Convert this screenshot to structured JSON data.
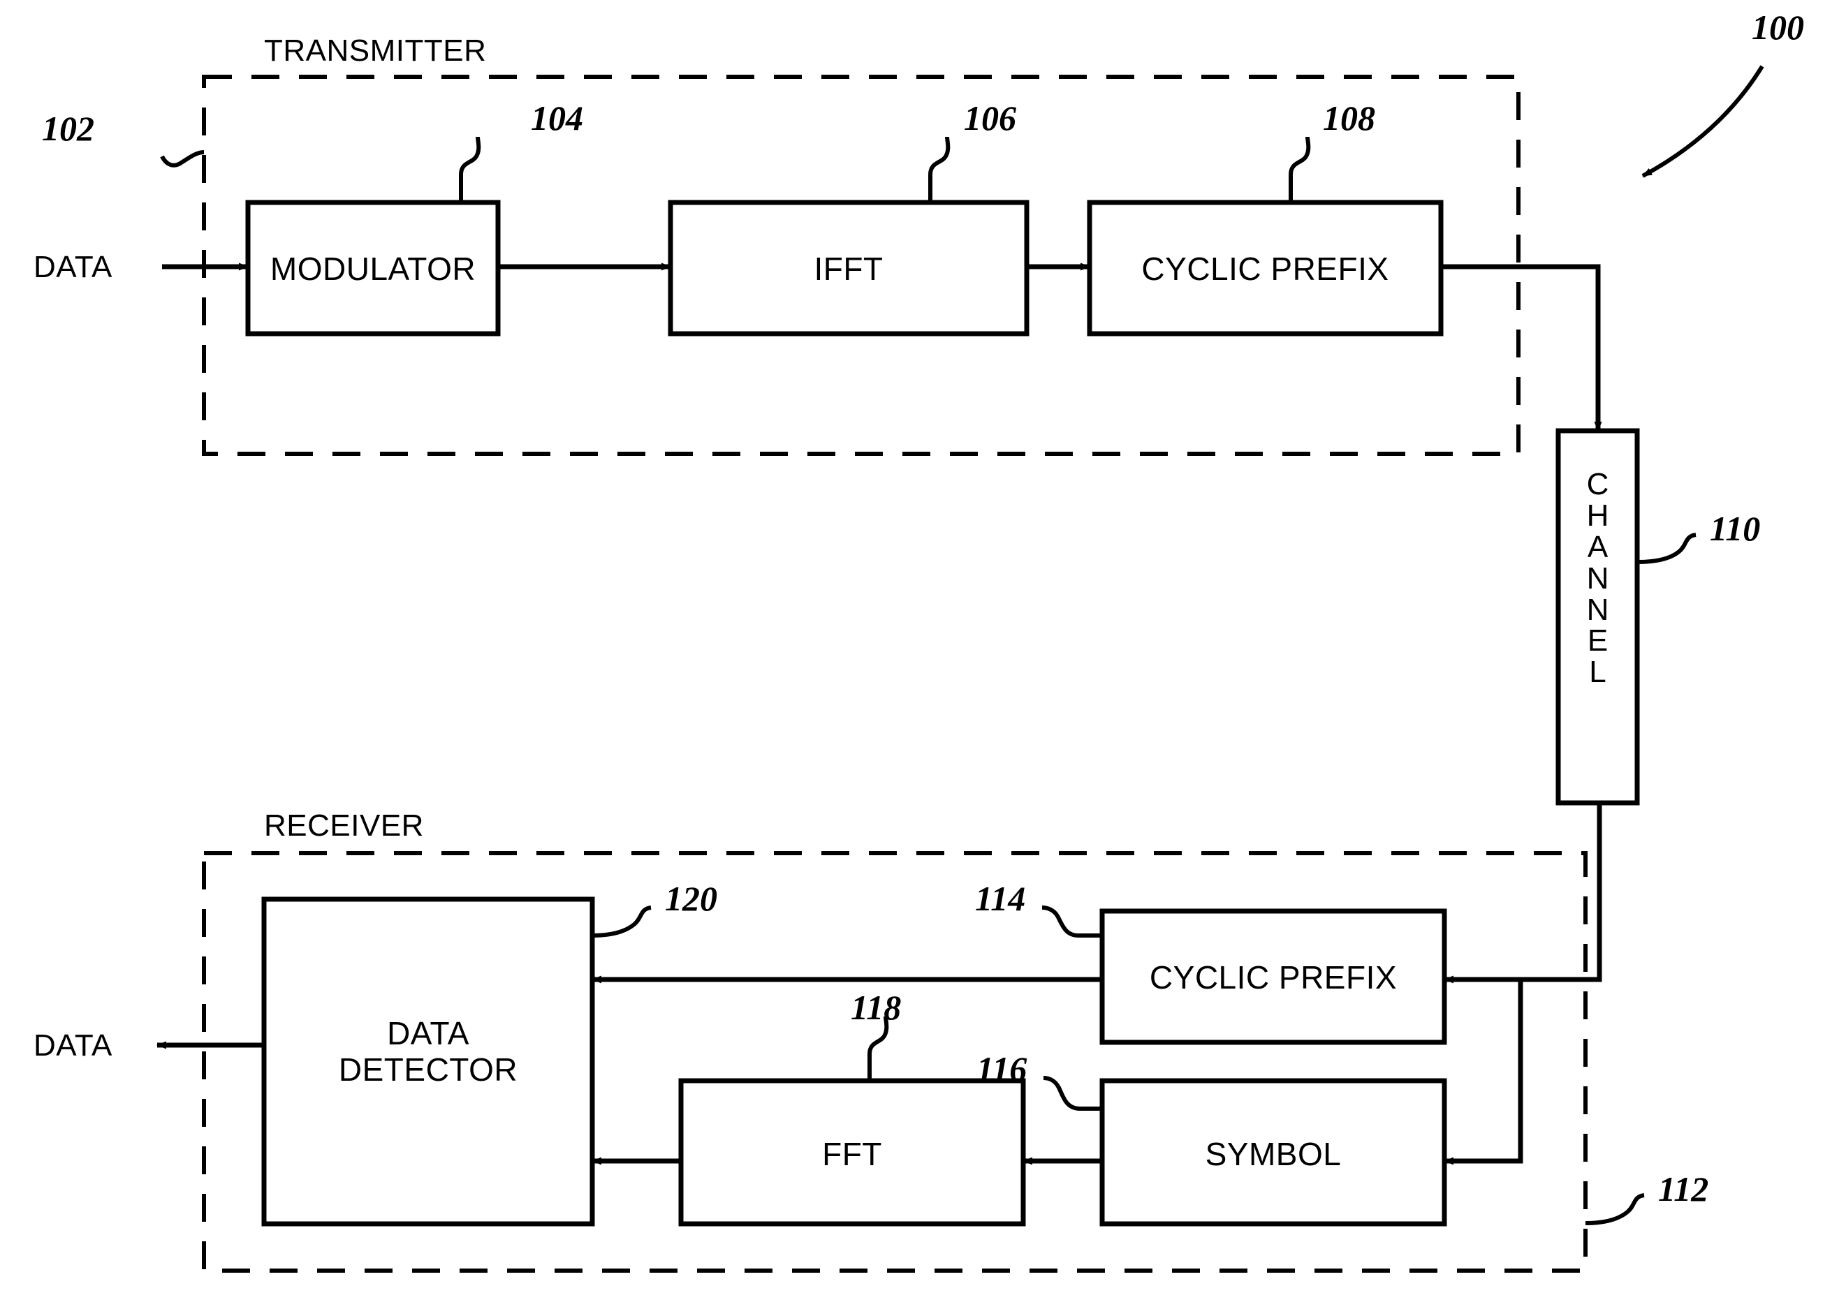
{
  "figure": {
    "reference_number": "100",
    "background_color": "#ffffff",
    "line_color": "#000000"
  },
  "sections": [
    {
      "id": "transmitter",
      "title": "TRANSMITTER",
      "reference_number": "102",
      "border_style": "dashed"
    },
    {
      "id": "receiver",
      "title": "RECEIVER",
      "reference_number": "112",
      "border_style": "dashed"
    }
  ],
  "io_labels": {
    "input_data": "DATA",
    "output_data": "DATA"
  },
  "blocks": [
    {
      "id": "modulator",
      "label": "MODULATOR",
      "reference_number": "104"
    },
    {
      "id": "ifft",
      "label": "IFFT",
      "reference_number": "106"
    },
    {
      "id": "cyclic_prefix_tx",
      "label": "CYCLIC PREFIX",
      "reference_number": "108"
    },
    {
      "id": "channel",
      "label": "CHANNEL",
      "reference_number": "110",
      "orientation": "vertical",
      "letters": [
        "C",
        "H",
        "A",
        "N",
        "N",
        "E",
        "L"
      ]
    },
    {
      "id": "cyclic_prefix_rx",
      "label": "CYCLIC PREFIX",
      "reference_number": "114"
    },
    {
      "id": "symbol",
      "label": "SYMBOL",
      "reference_number": "116"
    },
    {
      "id": "fft",
      "label": "FFT",
      "reference_number": "118"
    },
    {
      "id": "data_detector",
      "label": "DATA\nDETECTOR",
      "label_line1": "DATA",
      "label_line2": "DETECTOR",
      "reference_number": "120"
    }
  ],
  "connections": [
    {
      "from": "input_data",
      "to": "modulator"
    },
    {
      "from": "modulator",
      "to": "ifft"
    },
    {
      "from": "ifft",
      "to": "cyclic_prefix_tx"
    },
    {
      "from": "cyclic_prefix_tx",
      "to": "channel"
    },
    {
      "from": "channel",
      "to": "cyclic_prefix_rx"
    },
    {
      "from": "channel",
      "to": "symbol"
    },
    {
      "from": "cyclic_prefix_rx",
      "to": "data_detector"
    },
    {
      "from": "symbol",
      "to": "fft"
    },
    {
      "from": "fft",
      "to": "data_detector"
    },
    {
      "from": "data_detector",
      "to": "output_data"
    }
  ]
}
